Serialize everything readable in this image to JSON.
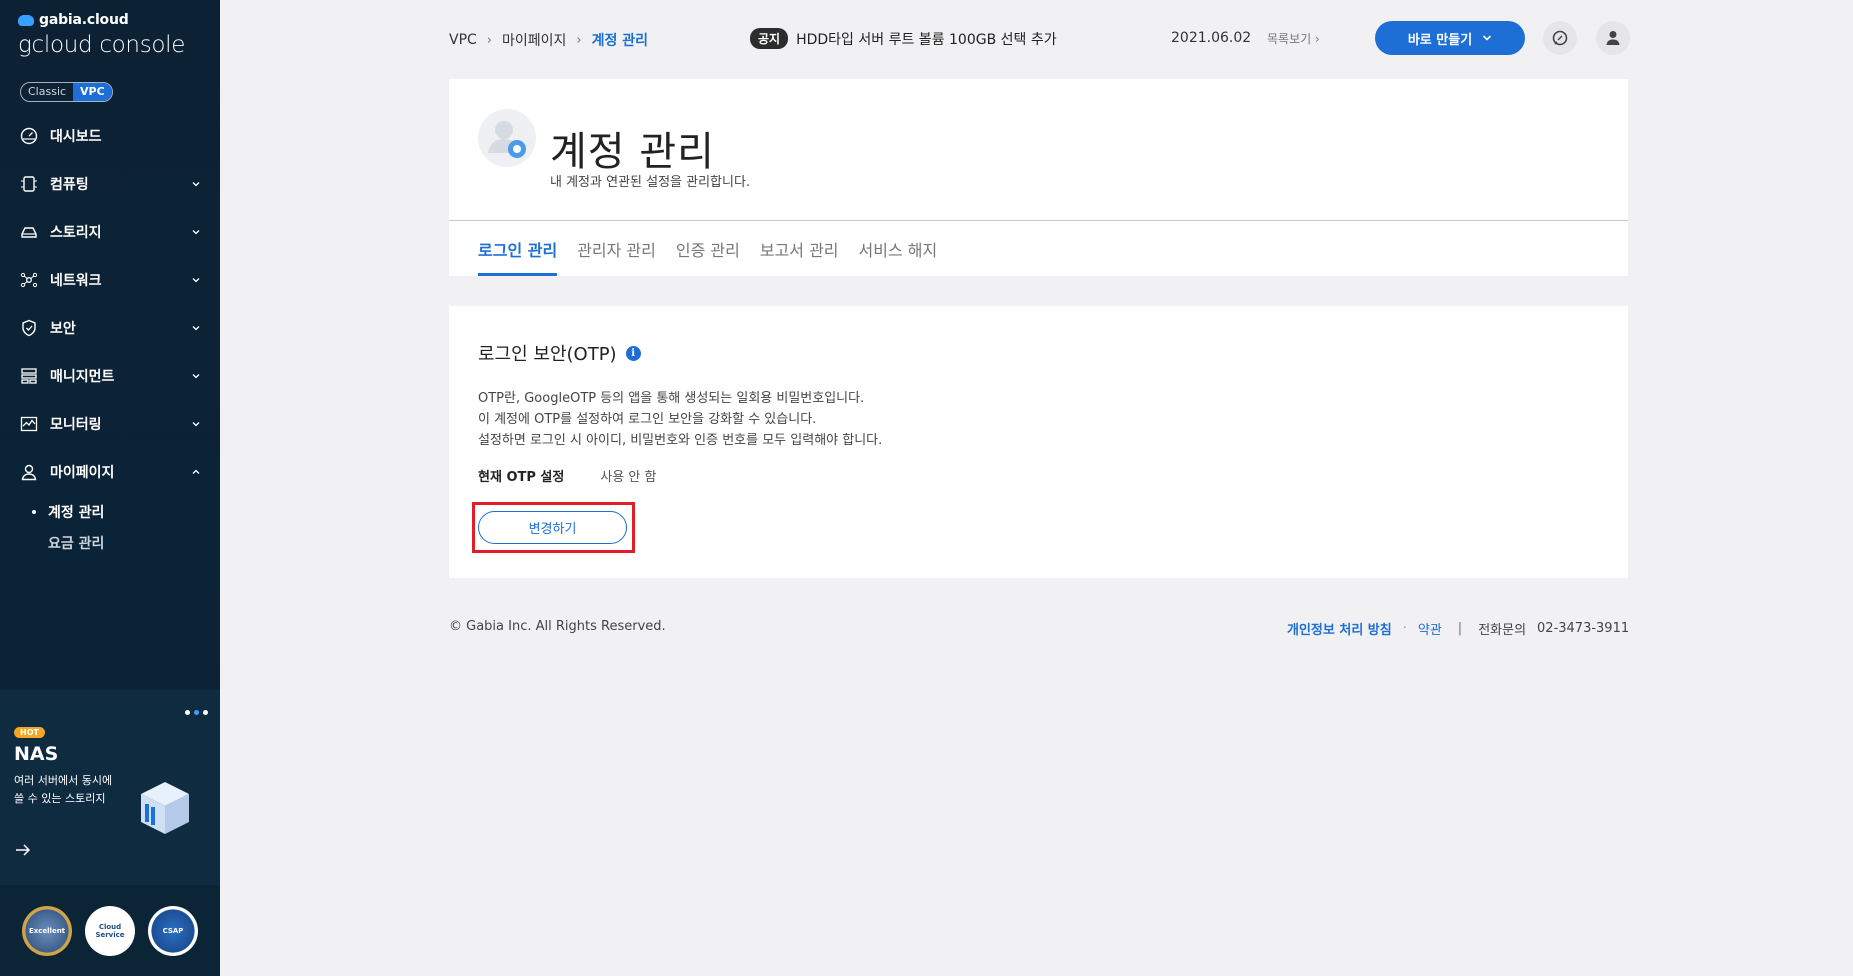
{
  "sidebar": {
    "brand": "gabia.cloud",
    "product_light": "gcloud ",
    "product_regular": "console",
    "switch": {
      "classic": "Classic",
      "vpc": "VPC"
    },
    "items": [
      {
        "label": "대시보드",
        "icon": "dashboard-icon"
      },
      {
        "label": "컴퓨팅",
        "icon": "cpu-icon"
      },
      {
        "label": "스토리지",
        "icon": "storage-icon"
      },
      {
        "label": "네트워크",
        "icon": "network-icon"
      },
      {
        "label": "보안",
        "icon": "shield-icon"
      },
      {
        "label": "매니지먼트",
        "icon": "management-icon"
      },
      {
        "label": "모니터링",
        "icon": "monitoring-icon"
      },
      {
        "label": "마이페이지",
        "icon": "user-icon"
      }
    ],
    "sub_items": [
      {
        "label": "계정 관리"
      },
      {
        "label": "요금 관리"
      }
    ],
    "promo": {
      "tag": "HOT",
      "title": "NAS",
      "desc_line1": "여러 서버에서 동시에",
      "desc_line2": "쓸 수 있는 스토리지"
    },
    "badges": [
      "Excellent",
      "Cloud Service",
      "CSAP"
    ]
  },
  "topbar": {
    "breadcrumb": [
      "VPC",
      "마이페이지",
      "계정 관리"
    ],
    "notice_tag": "공지",
    "notice_text": "HDD타입 서버 루트 볼륨 100GB 선택 추가",
    "notice_date": "2021.06.02",
    "notice_more": "목록보기",
    "make_button": "바로 만들기"
  },
  "page": {
    "title": "계정 관리",
    "subtitle": "내 계정과 연관된 설정을 관리합니다.",
    "tabs": [
      "로그인 관리",
      "관리자 관리",
      "인증 관리",
      "보고서 관리",
      "서비스 해지"
    ]
  },
  "otp": {
    "title": "로그인 보안(OTP)",
    "desc": [
      "OTP란, GoogleOTP 등의 앱을 통해 생성되는 일회용 비밀번호입니다.",
      "이 계정에 OTP를 설정하여 로그인 보안을 강화할 수 있습니다.",
      "설정하면 로그인 시 아이디, 비밀번호와 인증 번호를 모두 입력해야 합니다."
    ],
    "current_label": "현재 OTP 설정",
    "current_value": "사용 안 함",
    "change_button": "변경하기"
  },
  "footer": {
    "copyright": "© Gabia Inc. All Rights Reserved.",
    "privacy": "개인정보 처리 방침",
    "terms": "약관",
    "phone_label": "전화문의",
    "phone": "02-3473-3911"
  },
  "colors": {
    "accent": "#1d6fd6",
    "sidebar_bg": "#0d2134",
    "highlight": "#e31d25"
  }
}
